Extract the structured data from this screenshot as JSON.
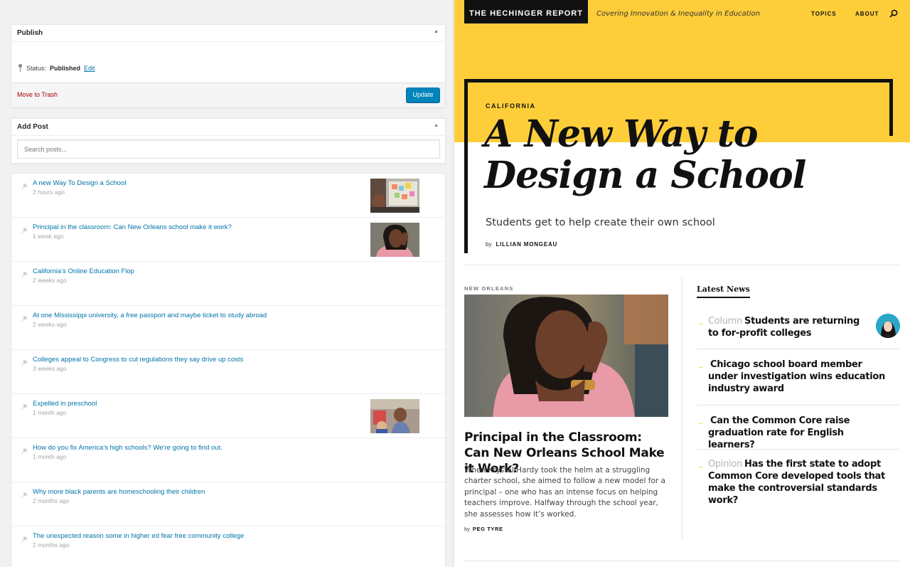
{
  "admin": {
    "publish": {
      "title": "Publish",
      "status_label": "Status:",
      "status_value": "Published",
      "edit_link": "Edit",
      "trash_link": "Move to Trash",
      "update_button": "Update"
    },
    "add_post": {
      "title": "Add Post",
      "search_placeholder": "Search posts..."
    },
    "posts": [
      {
        "title": "A new Way To Design a School",
        "time": "2 hours ago",
        "thumb": "classroom"
      },
      {
        "title": "Principal in the classroom: Can New Orleans school make it work?",
        "time": "1 week ago",
        "thumb": "principal"
      },
      {
        "title": "California’s Online Education Flop",
        "time": "2 weeks ago",
        "thumb": ""
      },
      {
        "title": "At one Mississippi university, a free passport and maybe ticket to study abroad",
        "time": "2 weeks ago",
        "thumb": ""
      },
      {
        "title": "Colleges appeal to Congress to cut regulations they say drive up costs",
        "time": "3 weeks ago",
        "thumb": ""
      },
      {
        "title": "Expelled in preschool",
        "time": "1 month ago",
        "thumb": "preschool"
      },
      {
        "title": "How do you fix America’s high schools? We’re going to find out.",
        "time": "1 month ago",
        "thumb": ""
      },
      {
        "title": "Why more black parents are homeschooling their children",
        "time": "2 months ago",
        "thumb": ""
      },
      {
        "title": "The unexpected reason some in higher ed fear free community college",
        "time": "2 months ago",
        "thumb": ""
      }
    ]
  },
  "site": {
    "logo": "THE HECHINGER REPORT",
    "tagline": "Covering Innovation & Inequality in Education",
    "nav": {
      "topics": "TOPICS",
      "about": "ABOUT"
    },
    "hero": {
      "kicker": "CALIFORNIA",
      "headline_line1": "A New Way to",
      "headline_line2": "Design a School",
      "dek": "Students get to help create their own school",
      "by": "by",
      "author": "LILLIAN MONGEAU"
    },
    "feature": {
      "section": "NEW ORLEANS",
      "title": "Principal in the Classroom: Can New Orleans School Make it Work?",
      "body": "When Krystal Hardy took the helm at a struggling charter school, she aimed to follow a new model for a principal – one who has an intense focus on helping teachers improve. Halfway through the school year, she assesses how it’s worked.",
      "by": "by",
      "author": "PEG TYRE"
    },
    "latest": {
      "heading": "Latest News",
      "items": [
        {
          "category": "Column",
          "text": "Students are returning to for-profit colleges"
        },
        {
          "category": "",
          "text": "Chicago school board member under investigation wins education industry award"
        },
        {
          "category": "",
          "text": "Can the Common Core raise graduation rate for English learners?"
        },
        {
          "category": "Opinion",
          "text": "Has the first state to adopt Common Core developed tools that make the controversial standards work?"
        }
      ]
    },
    "colors": {
      "brand_yellow": "#fece3a",
      "link_blue": "#0073aa",
      "button_blue": "#0085ba"
    }
  }
}
